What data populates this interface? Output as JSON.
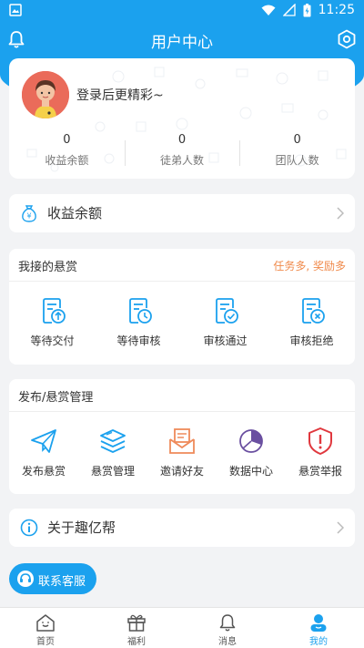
{
  "status": {
    "time": "11:25"
  },
  "header": {
    "title": "用户中心"
  },
  "profile": {
    "login_prompt": "登录后更精彩~",
    "stats": [
      {
        "value": "0",
        "label": "收益余额"
      },
      {
        "value": "0",
        "label": "徒弟人数"
      },
      {
        "value": "0",
        "label": "团队人数"
      }
    ]
  },
  "balance_row": {
    "label": "收益余额"
  },
  "my_tasks": {
    "title": "我接的悬赏",
    "promo": "任务多, 奖励多",
    "items": [
      {
        "label": "等待交付",
        "icon": "upload-doc-icon"
      },
      {
        "label": "等待审核",
        "icon": "clock-doc-icon"
      },
      {
        "label": "审核通过",
        "icon": "check-doc-icon"
      },
      {
        "label": "审核拒绝",
        "icon": "reject-doc-icon"
      }
    ]
  },
  "manage": {
    "title": "发布/悬赏管理",
    "items": [
      {
        "label": "发布悬赏",
        "icon": "paper-plane-icon"
      },
      {
        "label": "悬赏管理",
        "icon": "layers-icon"
      },
      {
        "label": "邀请好友",
        "icon": "envelope-icon"
      },
      {
        "label": "数据中心",
        "icon": "pie-chart-icon"
      },
      {
        "label": "悬赏举报",
        "icon": "shield-alert-icon"
      }
    ]
  },
  "about_row": {
    "label": "关于趣亿帮"
  },
  "service_button": {
    "label": "联系客服"
  },
  "tabs": [
    {
      "label": "首页",
      "icon": "home-icon"
    },
    {
      "label": "福利",
      "icon": "gift-icon"
    },
    {
      "label": "消息",
      "icon": "bell-icon"
    },
    {
      "label": "我的",
      "icon": "user-icon"
    }
  ],
  "colors": {
    "primary": "#1ba1ee",
    "promo": "#f08a4b",
    "report": "#e0383e",
    "data": "#6a4fa0",
    "invite": "#ef8a5a"
  }
}
